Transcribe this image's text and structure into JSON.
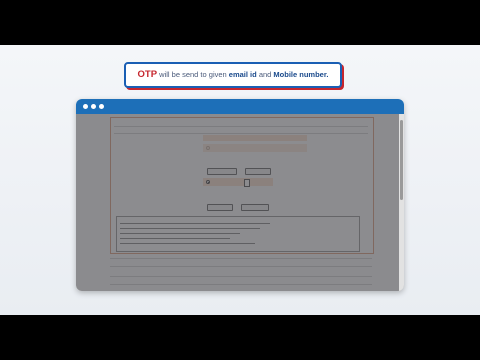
{
  "callout": {
    "otp": "OTP",
    "text1": " will be send to given ",
    "email": "email id",
    "and": " and ",
    "mobile": "Mobile number."
  },
  "colors": {
    "window_titlebar": "#1d6fb8",
    "callout_border": "#1a5fb4",
    "callout_accent": "#c6262e"
  }
}
